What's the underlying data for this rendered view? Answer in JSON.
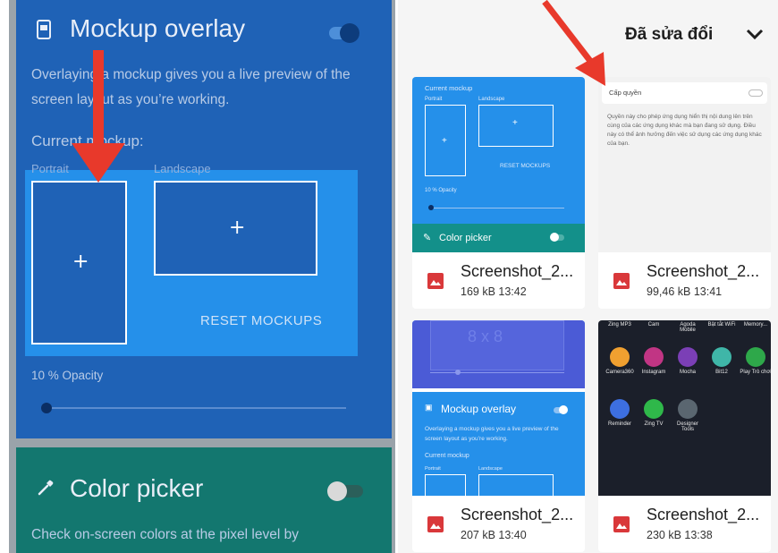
{
  "left_panel": {
    "mockup": {
      "title": "Mockup overlay",
      "description": "Overlaying a mockup gives you a live preview of the screen layout as you’re working.",
      "current_label": "Current mockup:",
      "portrait_label": "Portrait",
      "landscape_label": "Landscape",
      "plus_symbol": "+",
      "reset_label": "RESET MOCKUPS",
      "opacity_label": "10 % Opacity",
      "opacity_value": 0.1,
      "toggle_on": true
    },
    "color_picker": {
      "title": "Color picker",
      "description": "Check on-screen colors at the pixel level by",
      "toggle_on": false
    }
  },
  "right_panel": {
    "header_title": "Đã sửa đổi",
    "files": [
      {
        "name": "Screenshot_2...",
        "meta": "169 kB 13:42",
        "thumb": {
          "current_mockup": "Current mockup",
          "portrait": "Portrait",
          "landscape": "Landscape",
          "plus": "+",
          "reset": "RESET MOCKUPS",
          "opacity": "10 % Opacity",
          "color_picker": "Color picker"
        }
      },
      {
        "name": "Screenshot_2...",
        "meta": "99,46 kB 13:41",
        "thumb": {
          "heading": "Cấp quyền",
          "body": "Quyền này cho phép ứng dụng hiển thị nội dung lên trên cùng của các ứng dụng khác mà bạn đang sử dụng. Điều này có thể ảnh hưởng đến việc sử dụng các ứng dụng khác của bạn."
        }
      },
      {
        "name": "Screenshot_2...",
        "meta": "207 kB 13:40",
        "thumb": {
          "grid_label": "8 x 8",
          "title": "Mockup overlay",
          "desc": "Overlaying a mockup gives you a live preview of the screen layout as you’re working.",
          "current_mockup": "Current mockup",
          "portrait": "Portrait",
          "landscape": "Landscape"
        }
      },
      {
        "name": "Screenshot_2...",
        "meta": "230 kB 13:38",
        "thumb": {
          "top_labels": [
            "Zing MP3",
            "Cam",
            "Agoda Mobile",
            "Bật tắt WiFi",
            "Memory..."
          ],
          "apps": [
            {
              "label": "Camera360",
              "color": "#f0a030",
              "icon": "camera360-icon"
            },
            {
              "label": "Instagram",
              "color": "#c13584",
              "icon": "instagram-icon"
            },
            {
              "label": "Mocha",
              "color": "#7b3fb6",
              "icon": "mocha-icon"
            },
            {
              "label": "Bit12",
              "color": "#3fb6a8",
              "icon": "bit12-icon"
            },
            {
              "label": "Play Trò chơi",
              "color": "#2ea84a",
              "icon": "play-games-icon"
            },
            {
              "label": "Reminder",
              "color": "#3d6fe0",
              "icon": "reminder-icon"
            },
            {
              "label": "Zing TV",
              "color": "#2fb84a",
              "icon": "zing-tv-icon"
            },
            {
              "label": "Designer Tools",
              "color": "#5a6670",
              "icon": "designer-tools-icon"
            }
          ]
        }
      }
    ]
  },
  "colors": {
    "mockup_card": "#1f62b6",
    "highlight": "#2590ea",
    "color_picker_card": "#13776f",
    "arrow": "#e8392b",
    "file_icon": "#d9383a"
  }
}
